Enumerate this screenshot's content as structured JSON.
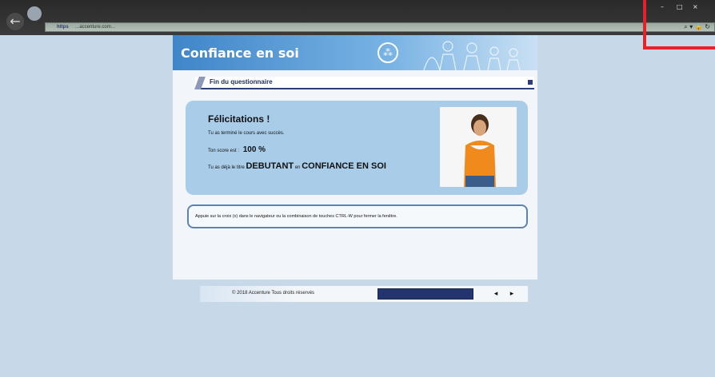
{
  "browser": {
    "back_icon": "arrow-left-icon",
    "address_prefix": "https",
    "address_url": "…accenture.com…",
    "tools_glyphs": "⌕ ▾ 🔒 ↻",
    "window_controls": [
      "–",
      "□",
      "×"
    ]
  },
  "course": {
    "banner_title": "Confiance en soi",
    "section_title": "Fin du questionnaire",
    "congrats_title": "Félicitations !",
    "completed_text": "Tu as terminé le cours avec succès.",
    "score_label": "Ton score est :",
    "score_value": "100 %",
    "level_prefix": "Tu as déjà le titre",
    "level_name": "DEBUTANT",
    "level_connector": "en",
    "level_topic": "CONFIANCE EN SOI",
    "info_text": "Appuie sur la croix (x) dans le navigateur ou la combinaison de touches CTRL-W pour fermer la fenêtre."
  },
  "footer": {
    "copyright": "© 2018 Accenture Tous droits réservés",
    "progress_fraction": 1.0,
    "prev_label": "◂",
    "next_label": "▸"
  },
  "colors": {
    "banner": "#3f86c9",
    "panel": "#a9cde9",
    "dark_blue": "#23346f",
    "highlight": "#e8202a"
  }
}
